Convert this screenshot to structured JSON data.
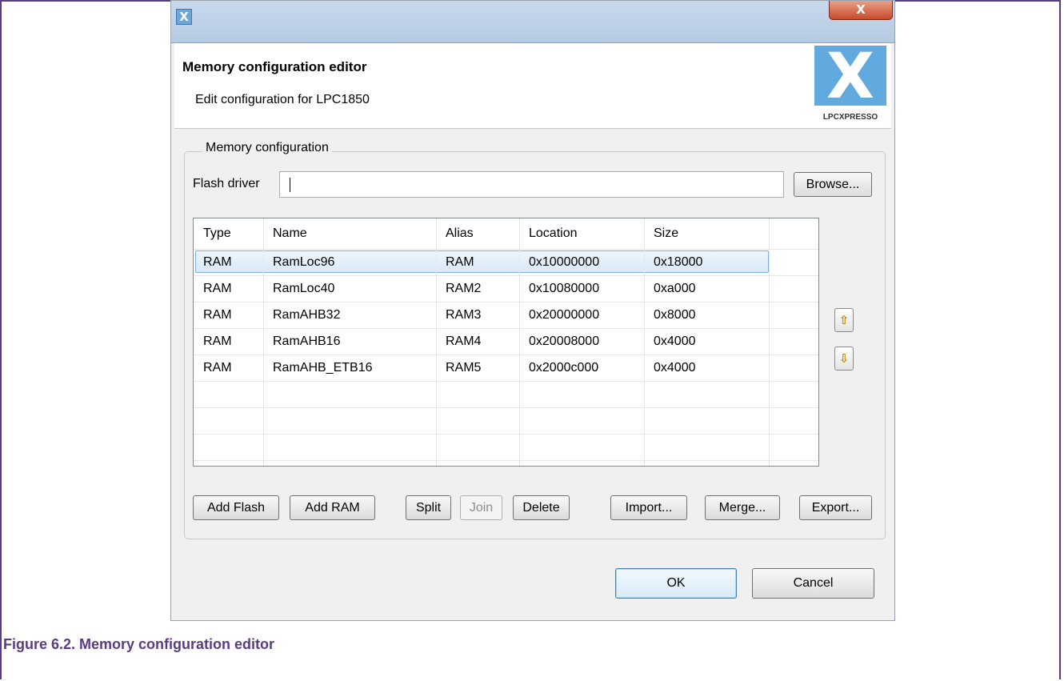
{
  "window": {
    "app_icon": "X",
    "close_glyph": "X"
  },
  "header": {
    "title": "Memory configuration editor",
    "subtitle": "Edit configuration for LPC1850",
    "logo_mark": "X",
    "logo_text": "LPCXPRESSO"
  },
  "memory_group": {
    "label": "Memory configuration",
    "flash_driver_label": "Flash driver",
    "flash_driver_value": "",
    "browse_label": "Browse..."
  },
  "table": {
    "columns": [
      "Type",
      "Name",
      "Alias",
      "Location",
      "Size"
    ],
    "rows": [
      [
        "RAM",
        "RamLoc96",
        "RAM",
        "0x10000000",
        "0x18000"
      ],
      [
        "RAM",
        "RamLoc40",
        "RAM2",
        "0x10080000",
        "0xa000"
      ],
      [
        "RAM",
        "RamAHB32",
        "RAM3",
        "0x20000000",
        "0x8000"
      ],
      [
        "RAM",
        "RamAHB16",
        "RAM4",
        "0x20008000",
        "0x4000"
      ],
      [
        "RAM",
        "RamAHB_ETB16",
        "RAM5",
        "0x2000c000",
        "0x4000"
      ]
    ],
    "selected_row": 0
  },
  "side_buttons": {
    "move_up_icon": "arrow-up-icon",
    "move_down_icon": "arrow-down-icon"
  },
  "actions": {
    "add_flash": "Add Flash",
    "add_ram": "Add RAM",
    "split": "Split",
    "join": "Join",
    "delete": "Delete",
    "import": "Import...",
    "merge": "Merge...",
    "export": "Export..."
  },
  "dialog_buttons": {
    "ok": "OK",
    "cancel": "Cancel"
  },
  "caption": "Figure 6.2. Memory configuration editor",
  "colors": {
    "accent": "#5b3b82",
    "logo": "#60aadf",
    "selection": "#d9e9f9"
  }
}
